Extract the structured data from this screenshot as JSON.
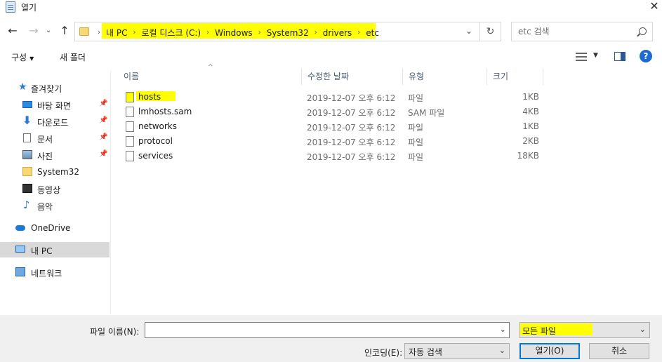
{
  "window": {
    "title": "열기",
    "close_glyph": "✕"
  },
  "nav": {
    "back": "←",
    "forward": "→",
    "recent": "⌄",
    "up": "↑",
    "refresh": "↻",
    "address_dropdown": "⌄"
  },
  "address": {
    "crumbs": [
      "내 PC",
      "로컬 디스크 (C:)",
      "Windows",
      "System32",
      "drivers",
      "etc"
    ],
    "separator": "›"
  },
  "search": {
    "placeholder": "etc 검색"
  },
  "toolbar": {
    "organize": "구성",
    "organize_caret": "▼",
    "new_folder": "새 폴더",
    "view_caret": "▼",
    "help": "?"
  },
  "sidebar": {
    "pin_glyph": "📌",
    "items": [
      {
        "label": "즐겨찾기",
        "icon": "star-icon",
        "glyph": "★"
      },
      {
        "label": "바탕 화면",
        "icon": "desktop-icon",
        "glyph": ""
      },
      {
        "label": "다운로드",
        "icon": "download-icon",
        "glyph": "⬇"
      },
      {
        "label": "문서",
        "icon": "document-icon",
        "glyph": ""
      },
      {
        "label": "사진",
        "icon": "pictures-icon",
        "glyph": ""
      },
      {
        "label": "System32",
        "icon": "folder-icon",
        "glyph": ""
      },
      {
        "label": "동영상",
        "icon": "video-icon",
        "glyph": ""
      },
      {
        "label": "음악",
        "icon": "music-icon",
        "glyph": "♪"
      },
      {
        "label": "OneDrive",
        "icon": "cloud-icon",
        "glyph": ""
      },
      {
        "label": "내 PC",
        "icon": "computer-icon",
        "glyph": ""
      },
      {
        "label": "네트워크",
        "icon": "network-icon",
        "glyph": ""
      }
    ]
  },
  "columns": {
    "name": "이름",
    "modified": "수정한 날짜",
    "type": "유형",
    "size": "크기",
    "sort_glyph": "^"
  },
  "files": [
    {
      "name": "hosts",
      "modified": "2019-12-07 오후 6:12",
      "type": "파일",
      "size": "1KB"
    },
    {
      "name": "lmhosts.sam",
      "modified": "2019-12-07 오후 6:12",
      "type": "SAM 파일",
      "size": "4KB"
    },
    {
      "name": "networks",
      "modified": "2019-12-07 오후 6:12",
      "type": "파일",
      "size": "1KB"
    },
    {
      "name": "protocol",
      "modified": "2019-12-07 오후 6:12",
      "type": "파일",
      "size": "2KB"
    },
    {
      "name": "services",
      "modified": "2019-12-07 오후 6:12",
      "type": "파일",
      "size": "18KB"
    }
  ],
  "bottom": {
    "filename_label": "파일 이름(N):",
    "filename_value": "",
    "filetype_value": "모든 파일",
    "encoding_label": "인코딩(E):",
    "encoding_value": "자동 검색",
    "dropdown_glyph": "⌄",
    "open_button": "열기(O)",
    "cancel_button": "취소"
  },
  "colors": {
    "highlight": "#ffff00",
    "accent": "#0078d7",
    "selected_bg": "#d9d9d9",
    "header_text": "#4c607a"
  }
}
